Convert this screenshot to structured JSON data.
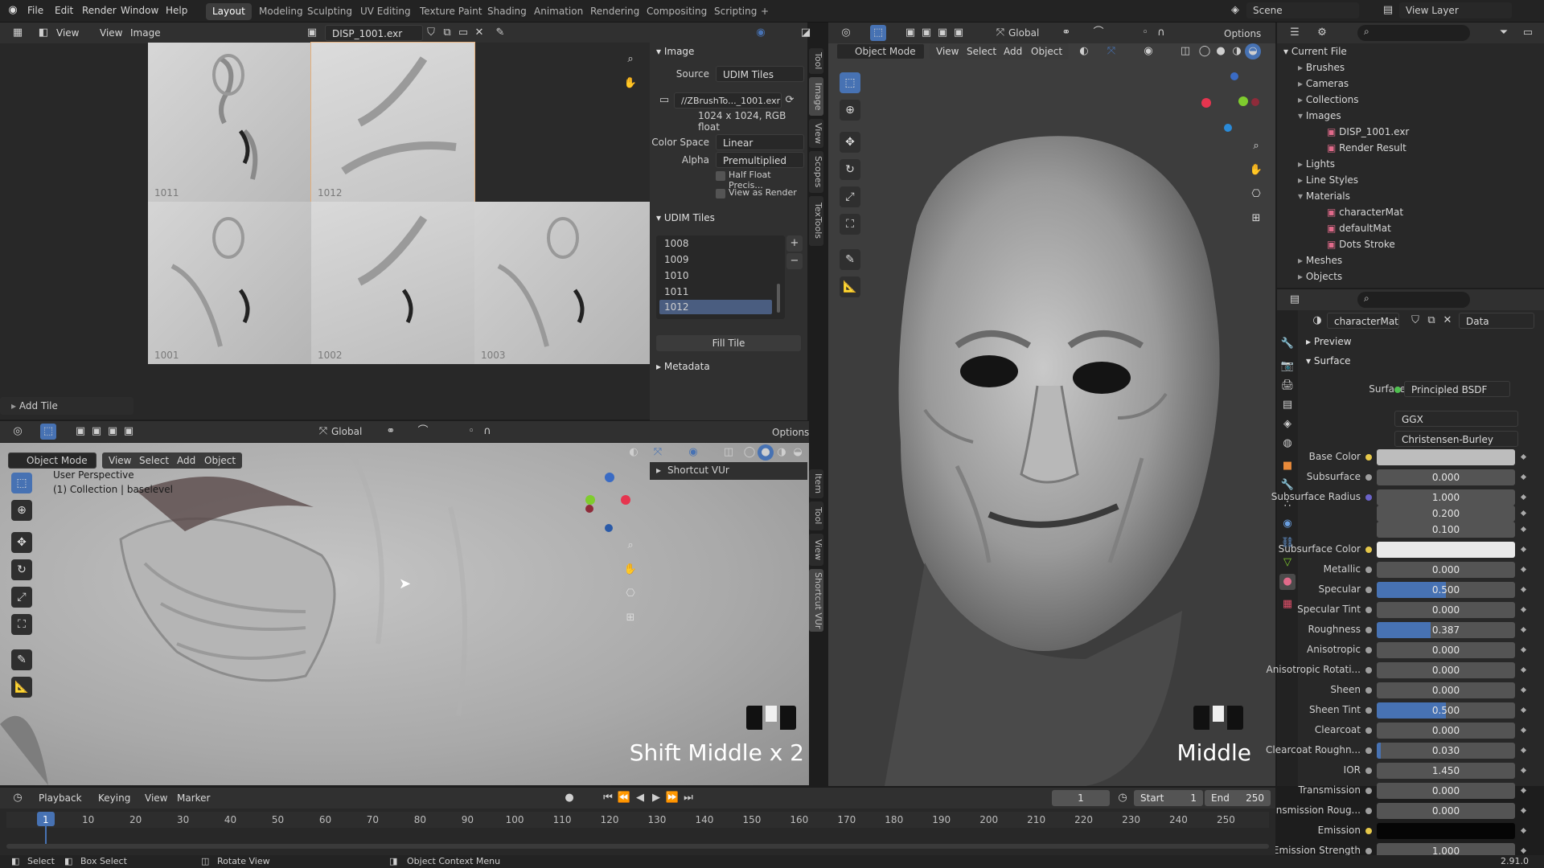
{
  "topmenu": [
    "File",
    "Edit",
    "Render",
    "Window",
    "Help"
  ],
  "workspaces": [
    "Layout",
    "Modeling",
    "Sculpting",
    "UV Editing",
    "Texture Paint",
    "Shading",
    "Animation",
    "Rendering",
    "Compositing",
    "Scripting",
    "+"
  ],
  "scene": "Scene",
  "viewlayer": "View Layer",
  "image_editor": {
    "menus": [
      "View",
      "View",
      "Image"
    ],
    "image_name": "DISP_1001.exr",
    "tiles": [
      {
        "id": "1011"
      },
      {
        "id": "1012"
      },
      {
        "id": "1001"
      },
      {
        "id": "1002"
      },
      {
        "id": "1003"
      }
    ],
    "add_tile": "Add Tile",
    "tabs": [
      "Tool",
      "Image",
      "View",
      "Scopes",
      "TexTools"
    ],
    "image_panel": {
      "title": "Image",
      "source_label": "Source",
      "source_value": "UDIM Tiles",
      "filepath": "//ZBrushTo..._1001.exr",
      "info": "1024 x 1024,  RGB float",
      "colorspace_label": "Color Space",
      "colorspace_value": "Linear",
      "alpha_label": "Alpha",
      "alpha_value": "Premultiplied",
      "half_float": "Half Float Precis...",
      "view_as_render": "View as Render"
    },
    "udim_panel": {
      "title": "UDIM Tiles",
      "tiles": [
        "1008",
        "1009",
        "1010",
        "1011",
        "1012"
      ],
      "fill_tile": "Fill Tile"
    },
    "metadata": "Metadata"
  },
  "viewport_left": {
    "transform": "Global",
    "options": "Options",
    "mode": "Object Mode",
    "menus": [
      "View",
      "Select",
      "Add",
      "Object"
    ],
    "persp": "User Perspective",
    "collection": "(1) Collection | baselevel",
    "npanel": "Shortcut VUr",
    "tabs": [
      "Item",
      "Tool",
      "View",
      "Shortcut VUr"
    ],
    "overlay_text": "Shift Middle x 2"
  },
  "viewport_right": {
    "mode": "Object Mode",
    "menus": [
      "View",
      "Select",
      "Add",
      "Object"
    ],
    "transform": "Global",
    "options": "Options",
    "overlay_text": "Middle"
  },
  "outliner": {
    "root": "Current File",
    "items": [
      {
        "label": "Brushes",
        "level": 1,
        "open": false
      },
      {
        "label": "Cameras",
        "level": 1,
        "open": false
      },
      {
        "label": "Collections",
        "level": 1,
        "open": false
      },
      {
        "label": "Images",
        "level": 1,
        "open": true
      },
      {
        "label": "DISP_1001.exr",
        "level": 2
      },
      {
        "label": "Render Result",
        "level": 2
      },
      {
        "label": "Lights",
        "level": 1,
        "open": false
      },
      {
        "label": "Line Styles",
        "level": 1,
        "open": false
      },
      {
        "label": "Materials",
        "level": 1,
        "open": true
      },
      {
        "label": "characterMat",
        "level": 2
      },
      {
        "label": "defaultMat",
        "level": 2
      },
      {
        "label": "Dots Stroke",
        "level": 2
      },
      {
        "label": "Meshes",
        "level": 1,
        "open": false
      },
      {
        "label": "Objects",
        "level": 1,
        "open": false
      }
    ]
  },
  "properties": {
    "material": "characterMat",
    "data": "Data",
    "preview": "Preview",
    "surface_section": "Surface",
    "surface_label": "Surface",
    "surface_value": "Principled BSDF",
    "distribution": "GGX",
    "subsurface_method": "Christensen-Burley",
    "rows": [
      {
        "label": "Base Color",
        "value": "",
        "color": "#bdbdbd",
        "dot": "#e6c84a"
      },
      {
        "label": "Subsurface",
        "value": "0.000",
        "fill": 0,
        "dot": "#9e9e9e"
      },
      {
        "label": "Subsurface Radius",
        "value": "1.000",
        "fill": 0,
        "dot": "#6b63c8"
      },
      {
        "label": "",
        "value": "0.200",
        "fill": 0,
        "dot": ""
      },
      {
        "label": "",
        "value": "0.100",
        "fill": 0,
        "dot": ""
      },
      {
        "label": "Subsurface Color",
        "value": "",
        "color": "#e9e9e9",
        "dot": "#e6c84a"
      },
      {
        "label": "Metallic",
        "value": "0.000",
        "fill": 0,
        "dot": "#9e9e9e"
      },
      {
        "label": "Specular",
        "value": "0.500",
        "fill": 0.5,
        "dot": "#9e9e9e"
      },
      {
        "label": "Specular Tint",
        "value": "0.000",
        "fill": 0,
        "dot": "#9e9e9e"
      },
      {
        "label": "Roughness",
        "value": "0.387",
        "fill": 0.387,
        "dot": "#9e9e9e"
      },
      {
        "label": "Anisotropic",
        "value": "0.000",
        "fill": 0,
        "dot": "#9e9e9e"
      },
      {
        "label": "Anisotropic Rotati...",
        "value": "0.000",
        "fill": 0,
        "dot": "#9e9e9e"
      },
      {
        "label": "Sheen",
        "value": "0.000",
        "fill": 0,
        "dot": "#9e9e9e"
      },
      {
        "label": "Sheen Tint",
        "value": "0.500",
        "fill": 0.5,
        "dot": "#9e9e9e"
      },
      {
        "label": "Clearcoat",
        "value": "0.000",
        "fill": 0,
        "dot": "#9e9e9e"
      },
      {
        "label": "Clearcoat Roughn...",
        "value": "0.030",
        "fill": 0.03,
        "dot": "#9e9e9e"
      },
      {
        "label": "IOR",
        "value": "1.450",
        "fill": 0,
        "dot": "#9e9e9e"
      },
      {
        "label": "Transmission",
        "value": "0.000",
        "fill": 0,
        "dot": "#9e9e9e"
      },
      {
        "label": "Transmission Roug...",
        "value": "0.000",
        "fill": 0,
        "dot": "#9e9e9e"
      },
      {
        "label": "Emission",
        "value": "",
        "color": "#050505",
        "dot": "#e6c84a"
      },
      {
        "label": "Emission Strength",
        "value": "1.000",
        "fill": 0,
        "dot": "#9e9e9e"
      }
    ]
  },
  "timeline": {
    "menus": [
      "Playback",
      "Keying",
      "View",
      "Marker"
    ],
    "current": "1",
    "start_label": "Start",
    "start": "1",
    "end_label": "End",
    "end": "250",
    "ticks": [
      "1",
      "10",
      "20",
      "30",
      "40",
      "50",
      "60",
      "70",
      "80",
      "90",
      "100",
      "110",
      "120",
      "130",
      "140",
      "150",
      "160",
      "170",
      "180",
      "190",
      "200",
      "210",
      "220",
      "230",
      "240",
      "250"
    ]
  },
  "statusbar": {
    "select": "Select",
    "box_select": "Box Select",
    "rotate": "Rotate View",
    "context": "Object Context Menu",
    "version": "2.91.0"
  }
}
